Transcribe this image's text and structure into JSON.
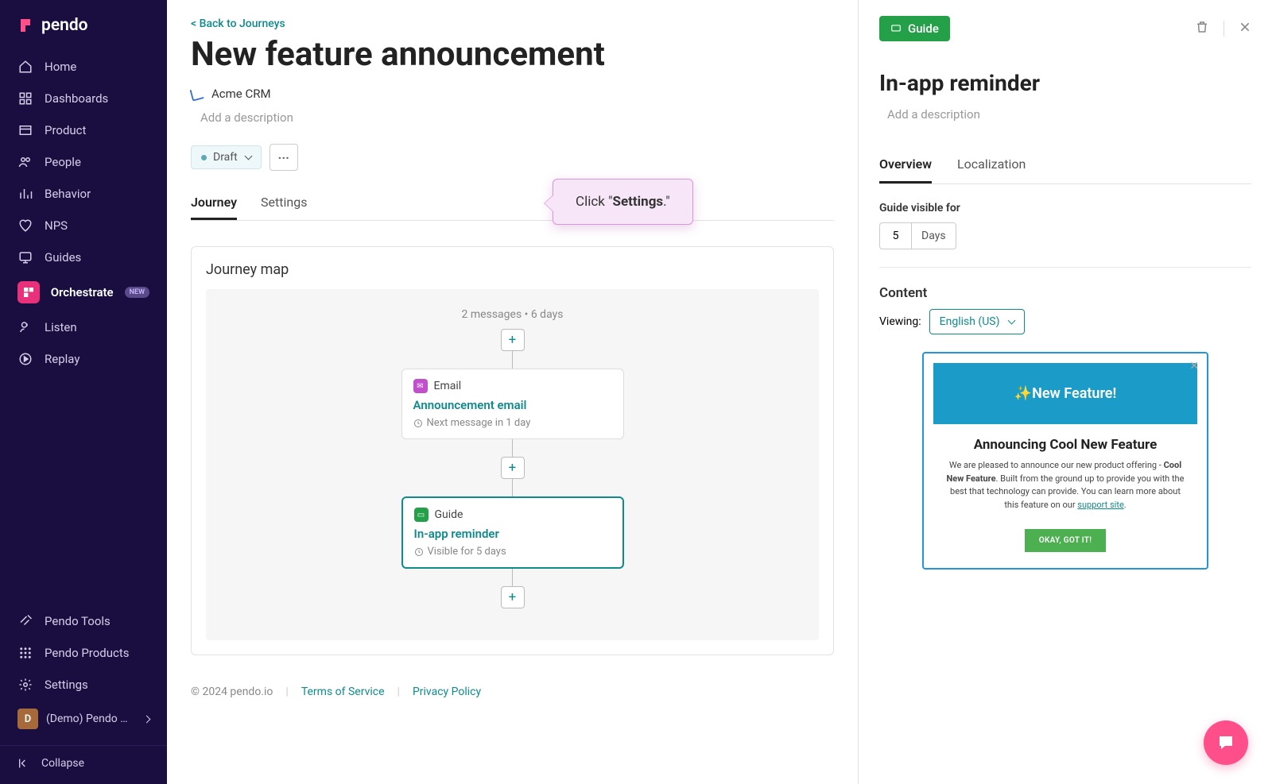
{
  "brand": "pendo",
  "sidebar": {
    "items": [
      {
        "label": "Home"
      },
      {
        "label": "Dashboards"
      },
      {
        "label": "Product"
      },
      {
        "label": "People"
      },
      {
        "label": "Behavior"
      },
      {
        "label": "NPS"
      },
      {
        "label": "Guides"
      },
      {
        "label": "Orchestrate",
        "badge": "NEW",
        "active": true
      },
      {
        "label": "Listen"
      },
      {
        "label": "Replay"
      }
    ],
    "bottom": [
      {
        "label": "Pendo Tools"
      },
      {
        "label": "Pendo Products"
      },
      {
        "label": "Settings"
      }
    ],
    "account": {
      "avatar": "D",
      "name": "(Demo) Pendo …"
    },
    "collapse": "Collapse"
  },
  "page": {
    "back": "< Back to Journeys",
    "title": "New feature announcement",
    "app": "Acme CRM",
    "desc_placeholder": "Add a description",
    "status": "Draft",
    "tabs": [
      "Journey",
      "Settings"
    ],
    "active_tab": "Journey"
  },
  "callout": {
    "pre": "Click \"",
    "bold": "Settings",
    "post": ".\""
  },
  "journey": {
    "title": "Journey map",
    "meta": "2 messages • 6 days",
    "add": "+",
    "nodes": [
      {
        "type": "Email",
        "title": "Announcement email",
        "sub": "Next message in 1 day"
      },
      {
        "type": "Guide",
        "title": "In-app reminder",
        "sub": "Visible for 5 days",
        "selected": true
      }
    ]
  },
  "footer": {
    "copyright": "© 2024 pendo.io",
    "tos": "Terms of Service",
    "privacy": "Privacy Policy"
  },
  "panel": {
    "badge": "Guide",
    "title": "In-app reminder",
    "desc_placeholder": "Add a description",
    "tabs": [
      "Overview",
      "Localization"
    ],
    "visible_label": "Guide visible for",
    "visible_value": "5",
    "visible_unit": "Days",
    "content_label": "Content",
    "viewing_label": "Viewing:",
    "language": "English (US)"
  },
  "preview": {
    "hero": "✨New Feature!",
    "heading": "Announcing Cool New Feature",
    "body_pre": "We are pleased to announce our new product offering - ",
    "body_bold": "Cool New Feature",
    "body_post": ". Built from the ground up to provide you with the best that technology can provide. You can learn more about this feature on our ",
    "body_link": "support site",
    "body_end": ".",
    "cta": "OKAY, GOT IT!"
  }
}
